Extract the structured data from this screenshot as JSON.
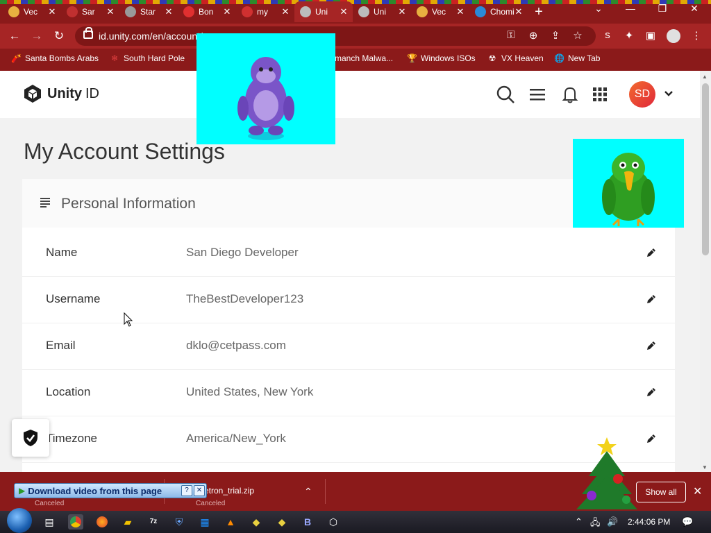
{
  "browser": {
    "tabs": [
      {
        "label": "Vec",
        "fav": "#e8b040"
      },
      {
        "label": "Sar",
        "fav": "#c03030"
      },
      {
        "label": "Star",
        "fav": "#999999"
      },
      {
        "label": "Bon",
        "fav": "#e03030"
      },
      {
        "label": "my",
        "fav": "#d03030"
      },
      {
        "label": "Uni",
        "fav": "#bbbbbb"
      },
      {
        "label": "Uni",
        "fav": "#bbbbbb"
      },
      {
        "label": "Vec",
        "fav": "#e8b040"
      },
      {
        "label": "Chomik",
        "fav": "#2a8ad8"
      }
    ],
    "new_tab": "+",
    "url": "id.unity.com/en/account/...",
    "bookmarks": [
      {
        "label": "Santa Bombs Arabs",
        "icon": "🧨"
      },
      {
        "label": "South Hard Pole",
        "icon": "❄"
      },
      {
        "label": "rmanch Malwa...",
        "icon": ""
      },
      {
        "label": "Windows ISOs",
        "icon": "🏆"
      },
      {
        "label": "VX Heaven",
        "icon": "☢"
      },
      {
        "label": "New Tab",
        "icon": "🌐"
      }
    ]
  },
  "site": {
    "brand": "Unity",
    "brand_suffix": "ID",
    "avatar": "SD",
    "page_title": "My Account Settings",
    "section_title": "Personal Information",
    "fields": [
      {
        "label": "Name",
        "value": "San Diego Developer"
      },
      {
        "label": "Username",
        "value": "TheBestDeveloper123"
      },
      {
        "label": "Email",
        "value": "dklo@cetpass.com"
      },
      {
        "label": "Location",
        "value": "United States, New York"
      },
      {
        "label": "Timezone",
        "value": "America/New_York"
      }
    ]
  },
  "downloads": {
    "video_helper": "Download video from this page",
    "items": [
      {
        "name": "",
        "status": "Canceled"
      },
      {
        "name": "cketron_trial.zip",
        "status": "Canceled"
      }
    ],
    "show_all": "Show all"
  },
  "taskbar": {
    "clock": "2:44:06 PM"
  },
  "colors": {
    "chrome_dark": "#8b1a1a",
    "chrome_light": "#a62525",
    "popup_bg": "#00ffff",
    "avatar_gradient": [
      "#f26a2e",
      "#e0283a"
    ]
  }
}
